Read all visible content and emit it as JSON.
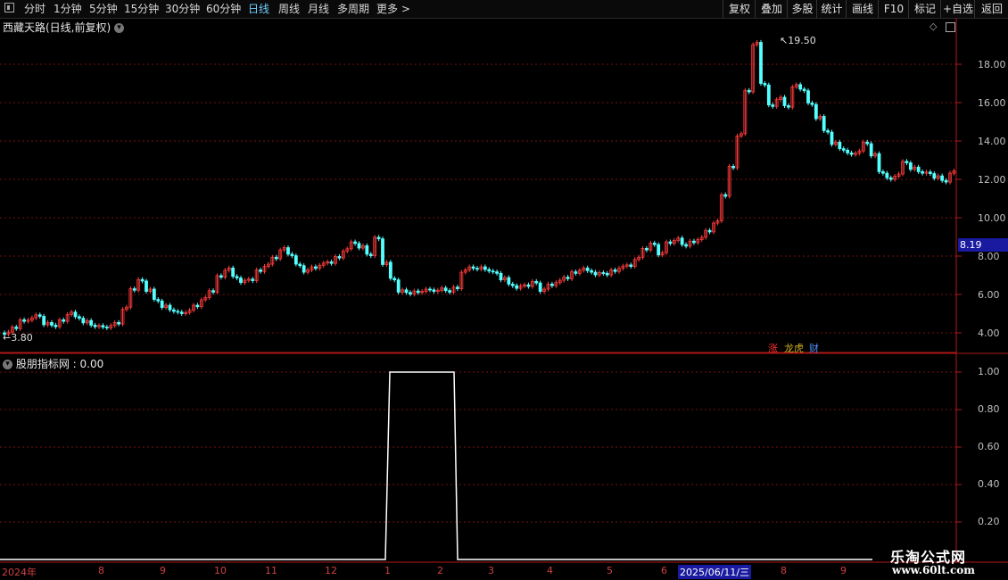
{
  "toolbar": {
    "periods": [
      "分时",
      "1分钟",
      "5分钟",
      "15分钟",
      "30分钟",
      "60分钟",
      "日线",
      "周线",
      "月线",
      "多周期",
      "更多"
    ],
    "active_period": "日线",
    "buttons": [
      "复权",
      "叠加",
      "多股",
      "统计",
      "画线",
      "F10",
      "+自选",
      "返回"
    ]
  },
  "main_chart": {
    "title": "西藏天路(日线,前复权)",
    "high_label": "19.50",
    "low_label": "3.80",
    "current_price": "8.19",
    "y_ticks": [
      "18.00",
      "16.00",
      "14.00",
      "12.00",
      "10.00",
      "8.00",
      "6.00",
      "4.00"
    ],
    "tags": [
      {
        "text": "涨",
        "color": "#ff3030"
      },
      {
        "text": "龙虎",
        "color": "#d0b020"
      },
      {
        "text": "财",
        "color": "#5090ff"
      }
    ]
  },
  "indicator": {
    "title": "股朋指标网 : 0.00",
    "y_ticks": [
      "1.00",
      "0.80",
      "0.60",
      "0.40",
      "0.20"
    ]
  },
  "x_axis": {
    "labels": [
      "2024年",
      "8",
      "9",
      "10",
      "11",
      "12",
      "1",
      "2",
      "3",
      "4",
      "5",
      "6",
      "2025/06/11/三",
      "8",
      "9"
    ],
    "highlight": "2025/06/11/三"
  },
  "watermark": {
    "line1": "乐淘公式网",
    "line2": "www.60lt.com"
  },
  "colors": {
    "up": "#ff3c3c",
    "down": "#54ffff",
    "grid": "#7a1010",
    "axis": "#b01818"
  },
  "chart_data": {
    "type": "candlestick",
    "price_series": [
      4.0,
      4.3,
      4.6,
      4.7,
      4.9,
      4.5,
      4.4,
      4.6,
      5.0,
      4.8,
      4.6,
      4.4,
      4.3,
      4.3,
      4.5,
      5.3,
      6.3,
      6.7,
      6.2,
      5.7,
      5.4,
      5.2,
      5.0,
      5.1,
      5.4,
      5.8,
      6.2,
      6.9,
      7.3,
      6.9,
      6.7,
      6.8,
      7.2,
      7.5,
      7.9,
      8.4,
      8.1,
      7.5,
      7.2,
      7.4,
      7.6,
      7.7,
      7.9,
      8.3,
      8.7,
      8.5,
      8.1,
      8.9,
      7.6,
      6.8,
      6.2,
      6.1,
      6.1,
      6.2,
      6.2,
      6.3,
      6.2,
      6.3,
      7.2,
      7.4,
      7.4,
      7.3,
      7.1,
      6.8,
      6.5,
      6.4,
      6.5,
      6.6,
      6.2,
      6.5,
      6.7,
      6.9,
      7.1,
      7.3,
      7.2,
      7.1,
      7.1,
      7.2,
      7.4,
      7.5,
      7.9,
      8.4,
      8.6,
      8.1,
      8.7,
      8.9,
      8.6,
      8.7,
      8.9,
      9.3,
      9.8,
      11.2,
      12.6,
      14.3,
      16.6,
      19.1,
      17.0,
      15.8,
      16.2,
      15.8,
      16.9,
      16.7,
      15.9,
      15.2,
      14.5,
      13.9,
      13.6,
      13.3,
      13.4,
      13.9,
      13.3,
      12.4,
      12.0,
      12.2,
      12.9,
      12.6,
      12.4,
      12.3,
      12.1,
      11.9,
      12.4
    ],
    "indicator": {
      "name": "股朋指标网",
      "current": 0.0,
      "high_range": [
        "1",
        "2"
      ],
      "high_value": 1.0,
      "low_value": 0.0
    },
    "ylim_price": [
      3.5,
      20
    ],
    "ylim_indicator": [
      0,
      1.05
    ]
  }
}
